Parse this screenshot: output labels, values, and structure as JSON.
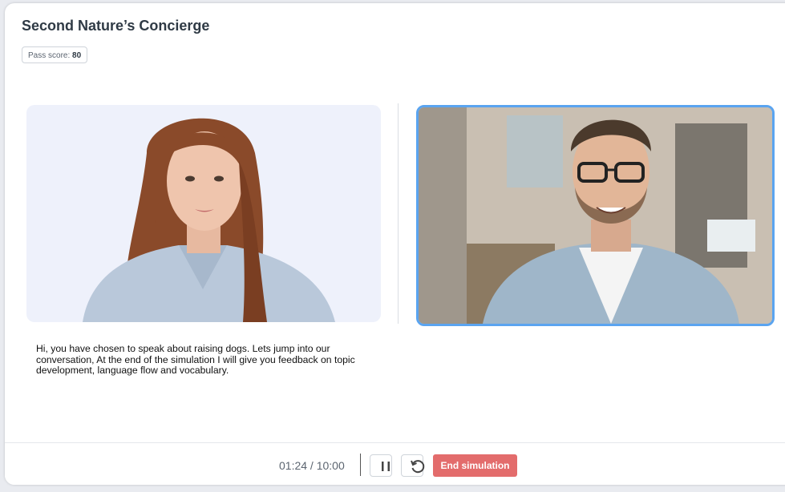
{
  "header": {
    "title": "Second Nature’s Concierge",
    "pass_label": "Pass score: ",
    "pass_value": "80"
  },
  "conversation": {
    "avatar_message": "Hi, you have chosen to speak about raising dogs. Lets jump into our conversation,  At the end of the simulation I will give you  feedback on topic development, language flow and vocabulary."
  },
  "controls": {
    "elapsed": "01:24",
    "separator": " / ",
    "total": "10:00",
    "pause_icon": "pause-icon",
    "restart_icon": "restart-icon",
    "end_label": "End simulation"
  },
  "colors": {
    "end_button": "#e36c6c",
    "webcam_border": "#5aa4f0",
    "avatar_bg": "#eef1fb"
  }
}
